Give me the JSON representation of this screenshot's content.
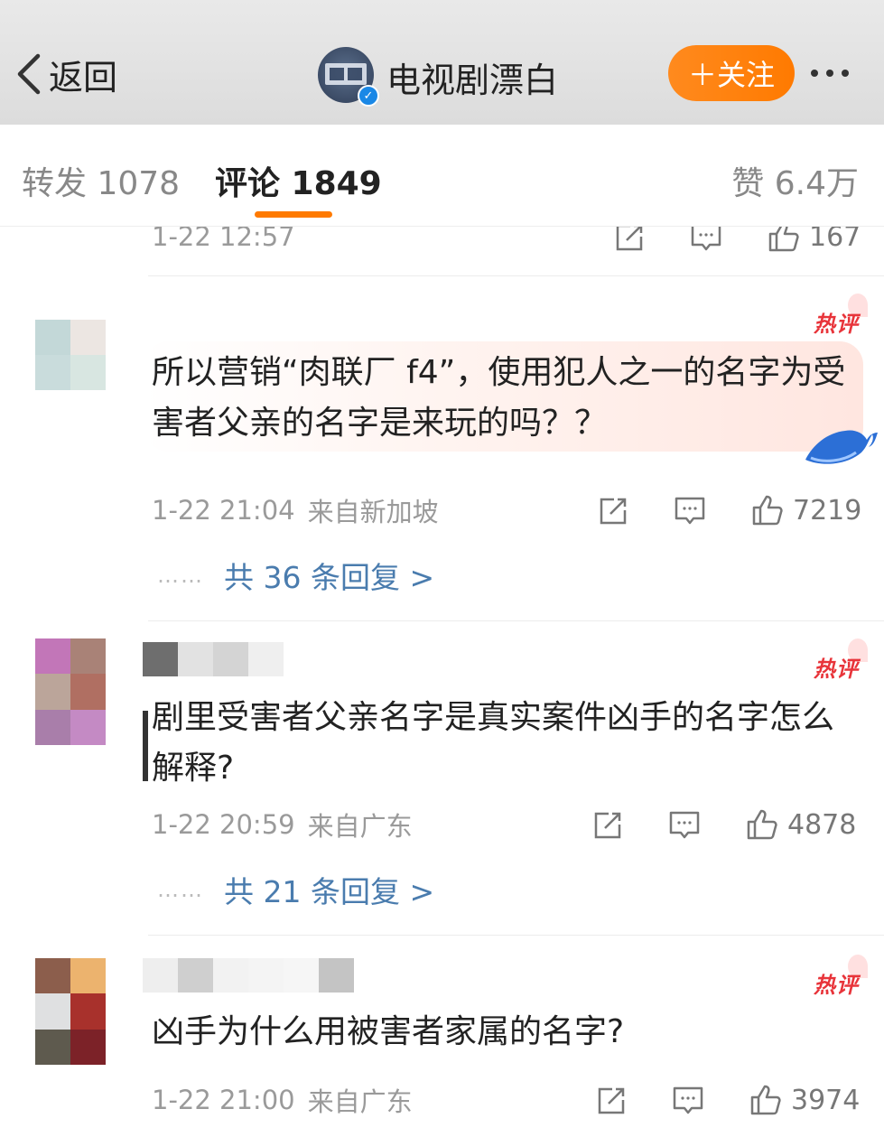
{
  "header": {
    "back_label": "返回",
    "account_name": "电视剧漂白",
    "follow_label": "＋关注",
    "brand_color": "#ff7a00"
  },
  "tabs": {
    "repost": "转发 1078",
    "comments": "评论 1849",
    "likes": "赞 6.4万"
  },
  "top_partial": {
    "time": "1-22 12:57",
    "likes": "167"
  },
  "comments": [
    {
      "badge": "热评",
      "text": "所以营销“肉联厂 f4”，使用犯人之一的名字为受害者父亲的名字是来玩的吗？？",
      "time": "1-22 21:04",
      "location": "来自新加坡",
      "likes": "7219",
      "replies_dots": "……",
      "replies_link": "共 36 条回复 >"
    },
    {
      "badge": "热评",
      "text": "剧里受害者父亲名字是真实案件凶手的名字怎么解释?",
      "time": "1-22 20:59",
      "location": "来自广东",
      "likes": "4878",
      "replies_dots": "……",
      "replies_link": "共 21 条回复 >"
    },
    {
      "badge": "热评",
      "text": "凶手为什么用被害者家属的名字?",
      "time": "1-22 21:00",
      "location": "来自广东",
      "likes": "3974"
    }
  ],
  "icons": [
    "chevron-left-icon",
    "verified-icon",
    "share-icon",
    "comment-icon",
    "like-icon",
    "whale-icon",
    "more-icon"
  ],
  "colors": {
    "hot_badge": "#e8343a",
    "reply_link": "#4a7cae",
    "meta": "#9a9a9a"
  }
}
